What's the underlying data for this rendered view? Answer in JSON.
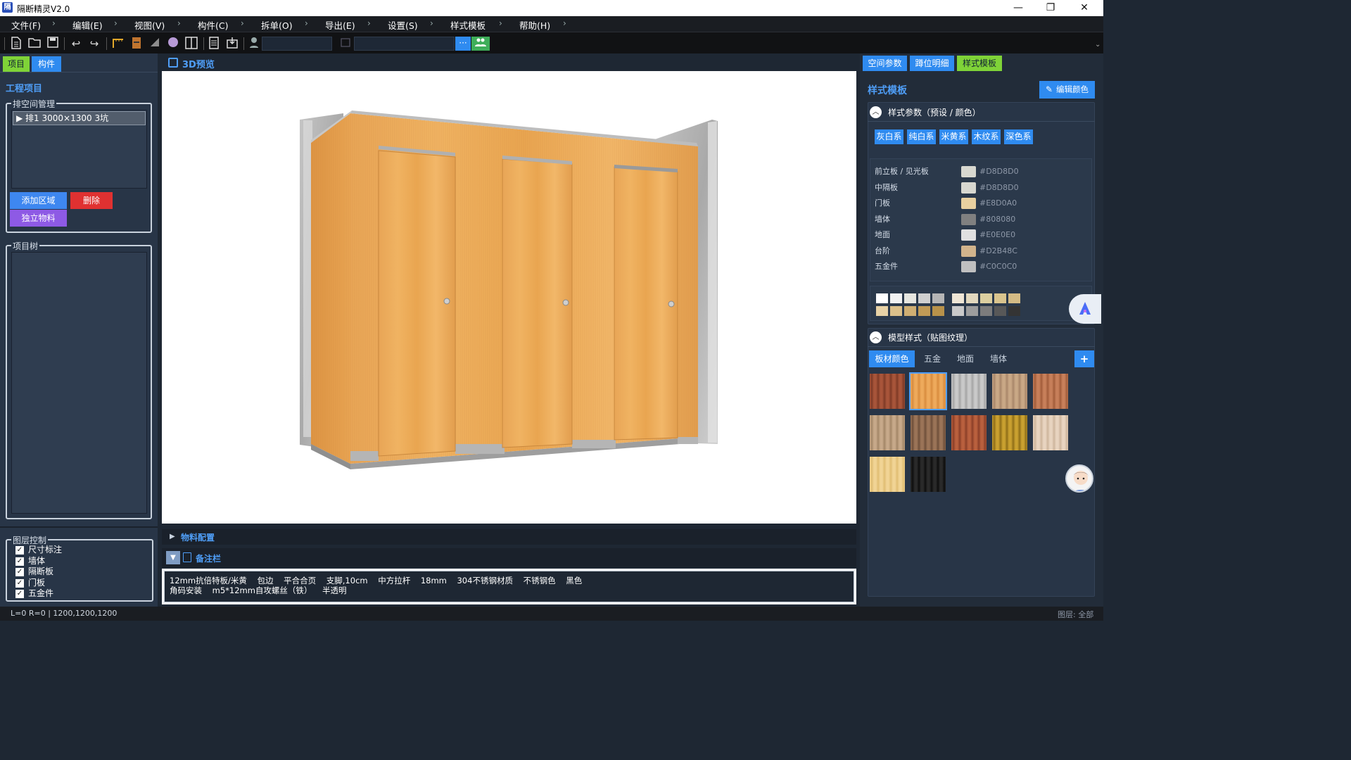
{
  "app": {
    "title": "隔断精灵V2.0",
    "logo": "隔"
  },
  "window_controls": {
    "minimize": "—",
    "restore": "❐",
    "close": "✕"
  },
  "menu": [
    "文件(F)",
    "编辑(E)",
    "视图(V)",
    "构件(C)",
    "拆单(O)",
    "导出(E)",
    "设置(S)",
    "样式模板",
    "帮助(H)"
  ],
  "toolbar": {
    "search_btn": "···"
  },
  "left": {
    "tabs": [
      "项目",
      "构件"
    ],
    "section_title": "工程项目",
    "arrange_group": "排空间管理",
    "arrange_item": "▶ 排1  3000×1300 3坑",
    "add_area": "添加区域",
    "delete": "删除",
    "standalone": "独立物料",
    "tree_group": "项目树",
    "layer_group": "图层控制",
    "layers": [
      "尺寸标注",
      "墙体",
      "隔断板",
      "门板",
      "五金件"
    ]
  },
  "center": {
    "preview_title": "3D预览",
    "materials_title": "物料配置",
    "notes_title": "备注栏",
    "notes_line1": "12mm抗倍特板/米黄    包边    平合合页    支脚,10cm    中方拉杆    18mm    304不锈钢材质    不锈钢色    黑色",
    "notes_line2": "角码安装    m5*12mm自攻螺丝（铁）    半透明"
  },
  "right": {
    "tabs": [
      "空间参数",
      "蹲位明细",
      "样式模板"
    ],
    "title": "样式模板",
    "edit_color": "编辑颜色",
    "style_params": "样式参数（预设 / 颜色）",
    "presets": [
      "灰白系",
      "纯白系",
      "米黄系",
      "木纹系",
      "深色系"
    ],
    "colors": [
      {
        "label": "前立板 / 见光板",
        "hex": "#D8D8D0"
      },
      {
        "label": "中隔板",
        "hex": "#D8D8D0"
      },
      {
        "label": "门板",
        "hex": "#E8D0A0"
      },
      {
        "label": "墙体",
        "hex": "#808080"
      },
      {
        "label": "地面",
        "hex": "#E0E0E0"
      },
      {
        "label": "台阶",
        "hex": "#D2B48C"
      },
      {
        "label": "五金件",
        "hex": "#C0C0C0"
      }
    ],
    "model_style": "模型样式（贴图纹理）",
    "texture_tabs": [
      "板材颜色",
      "五金",
      "地面",
      "墙体"
    ],
    "add_texture": "+"
  },
  "swatches_left": [
    "#ffffff",
    "#f2f2f2",
    "#e6e6e0",
    "#cfcfcf",
    "#b5b5b5",
    "#e8d2a6",
    "#dcc08a",
    "#cfae72",
    "#c09a56",
    "#b8924a"
  ],
  "swatches_right": [
    "#efe6d6",
    "#e2d8be",
    "#dccfa0",
    "#d9c48d",
    "#d4bb85",
    "#c9c9c9",
    "#9d9d9d",
    "#7c7c7c",
    "#585858",
    "#343434"
  ],
  "textures": [
    {
      "name": "red-wood",
      "a": "#a8553a",
      "b": "#7e3a26"
    },
    {
      "name": "orange-wood",
      "a": "#eeaa5c",
      "b": "#d88c3e"
    },
    {
      "name": "grey-stone",
      "a": "#c9c9c9",
      "b": "#a5a5a5"
    },
    {
      "name": "light-oak",
      "a": "#c9a886",
      "b": "#a9876a"
    },
    {
      "name": "cherry",
      "a": "#c77f5a",
      "b": "#a25c3a"
    },
    {
      "name": "beige-oak",
      "a": "#c7a98a",
      "b": "#a38667"
    },
    {
      "name": "walnut",
      "a": "#9b7458",
      "b": "#6e4f3a"
    },
    {
      "name": "rosewood",
      "a": "#b9603e",
      "b": "#8a3f28"
    },
    {
      "name": "golden-oak",
      "a": "#c9a030",
      "b": "#8e6e18"
    },
    {
      "name": "ivory-wood",
      "a": "#e8d4c0",
      "b": "#cdb59c"
    },
    {
      "name": "maple",
      "a": "#f1d495",
      "b": "#e0bd72"
    },
    {
      "name": "black-wood",
      "a": "#2a2a2a",
      "b": "#0d0d0d"
    }
  ],
  "status": {
    "left": "L=0 R=0 | 1200,1200,1200",
    "right": "图层: 全部"
  }
}
